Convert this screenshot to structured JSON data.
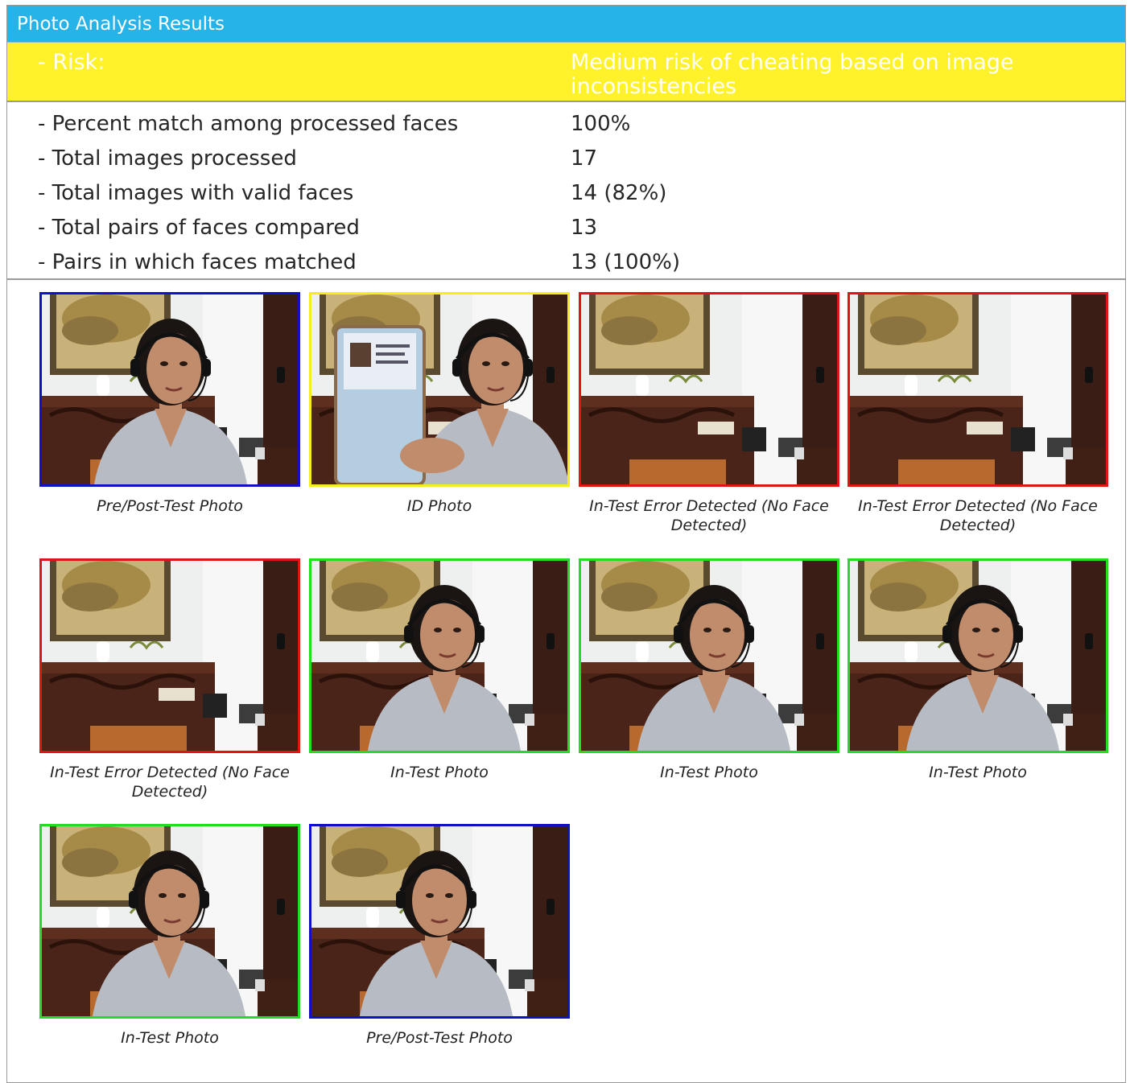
{
  "header": {
    "title": "Photo Analysis Results"
  },
  "risk": {
    "label": "- Risk:",
    "value": "Medium risk of cheating based on image inconsistencies"
  },
  "stats": [
    {
      "label": "- Percent match among processed faces",
      "value": "100%"
    },
    {
      "label": "- Total images processed",
      "value": "17"
    },
    {
      "label": "- Total images with valid faces",
      "value": "14 (82%)"
    },
    {
      "label": "- Total pairs of faces compared",
      "value": "13"
    },
    {
      "label": "- Pairs in which faces matched",
      "value": "13 (100%)"
    }
  ],
  "colors": {
    "header_bg": "#26b4e8",
    "risk_bg": "#fff22b",
    "border_pre_post": "#1010c8",
    "border_id": "#f5ee1c",
    "border_error": "#e01414",
    "border_in_test": "#22dd22"
  },
  "photos": [
    {
      "caption": "Pre/Post-Test Photo",
      "border": "blue",
      "subject": "face-front-smiling"
    },
    {
      "caption": "ID Photo",
      "border": "yellow",
      "subject": "face-with-id-card"
    },
    {
      "caption": "In-Test Error Detected (No Face Detected)",
      "border": "red",
      "subject": "empty-room"
    },
    {
      "caption": "In-Test Error Detected (No Face Detected)",
      "border": "red",
      "subject": "empty-room"
    },
    {
      "caption": "In-Test Error Detected (No Face Detected)",
      "border": "red",
      "subject": "empty-room"
    },
    {
      "caption": "In-Test Photo",
      "border": "green",
      "subject": "face-side"
    },
    {
      "caption": "In-Test Photo",
      "border": "green",
      "subject": "face-side"
    },
    {
      "caption": "In-Test Photo",
      "border": "green",
      "subject": "face-side"
    },
    {
      "caption": "In-Test Photo",
      "border": "green",
      "subject": "face-eyes-down"
    },
    {
      "caption": "Pre/Post-Test Photo",
      "border": "blue",
      "subject": "face-front"
    }
  ]
}
